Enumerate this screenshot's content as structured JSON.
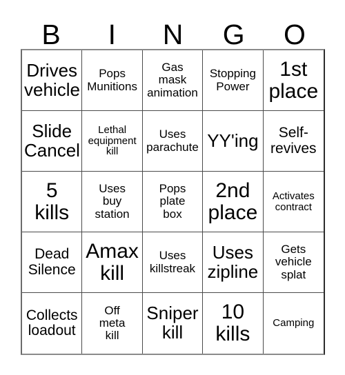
{
  "header": {
    "letters": [
      "B",
      "I",
      "N",
      "G",
      "O"
    ]
  },
  "grid": {
    "rows": 5,
    "columns": 5,
    "cells": [
      {
        "text": "Drives\nvehicle",
        "size": "fs-lg"
      },
      {
        "text": "Pops\nMunitions",
        "size": "fs-sm"
      },
      {
        "text": "Gas\nmask\nanimation",
        "size": "fs-sm"
      },
      {
        "text": "Stopping\nPower",
        "size": "fs-sm"
      },
      {
        "text": "1st\nplace",
        "size": "fs-xl"
      },
      {
        "text": "Slide\nCancel",
        "size": "fs-lg"
      },
      {
        "text": "Lethal\nequipment\nkill",
        "size": "fs-xs"
      },
      {
        "text": "Uses\nparachute",
        "size": "fs-sm"
      },
      {
        "text": "YY'ing",
        "size": "fs-lg"
      },
      {
        "text": "Self-\nrevives",
        "size": "fs-md"
      },
      {
        "text": "5\nkills",
        "size": "fs-xl"
      },
      {
        "text": "Uses\nbuy\nstation",
        "size": "fs-sm"
      },
      {
        "text": "Pops\nplate\nbox",
        "size": "fs-sm"
      },
      {
        "text": "2nd\nplace",
        "size": "fs-xl"
      },
      {
        "text": "Activates\ncontract",
        "size": "fs-xs"
      },
      {
        "text": "Dead\nSilence",
        "size": "fs-md"
      },
      {
        "text": "Amax\nkill",
        "size": "fs-xl"
      },
      {
        "text": "Uses\nkillstreak",
        "size": "fs-sm"
      },
      {
        "text": "Uses\nzipline",
        "size": "fs-lg"
      },
      {
        "text": "Gets\nvehicle\nsplat",
        "size": "fs-sm"
      },
      {
        "text": "Collects\nloadout",
        "size": "fs-md"
      },
      {
        "text": "Off\nmeta\nkill",
        "size": "fs-sm"
      },
      {
        "text": "Sniper\nkill",
        "size": "fs-lg"
      },
      {
        "text": "10\nkills",
        "size": "fs-xl"
      },
      {
        "text": "Camping",
        "size": "fs-xs"
      }
    ]
  },
  "colors": {
    "background": "#ffffff",
    "text": "#000000",
    "grid_line": "#4a4a4a",
    "outer_border": "#8a8a8a"
  }
}
